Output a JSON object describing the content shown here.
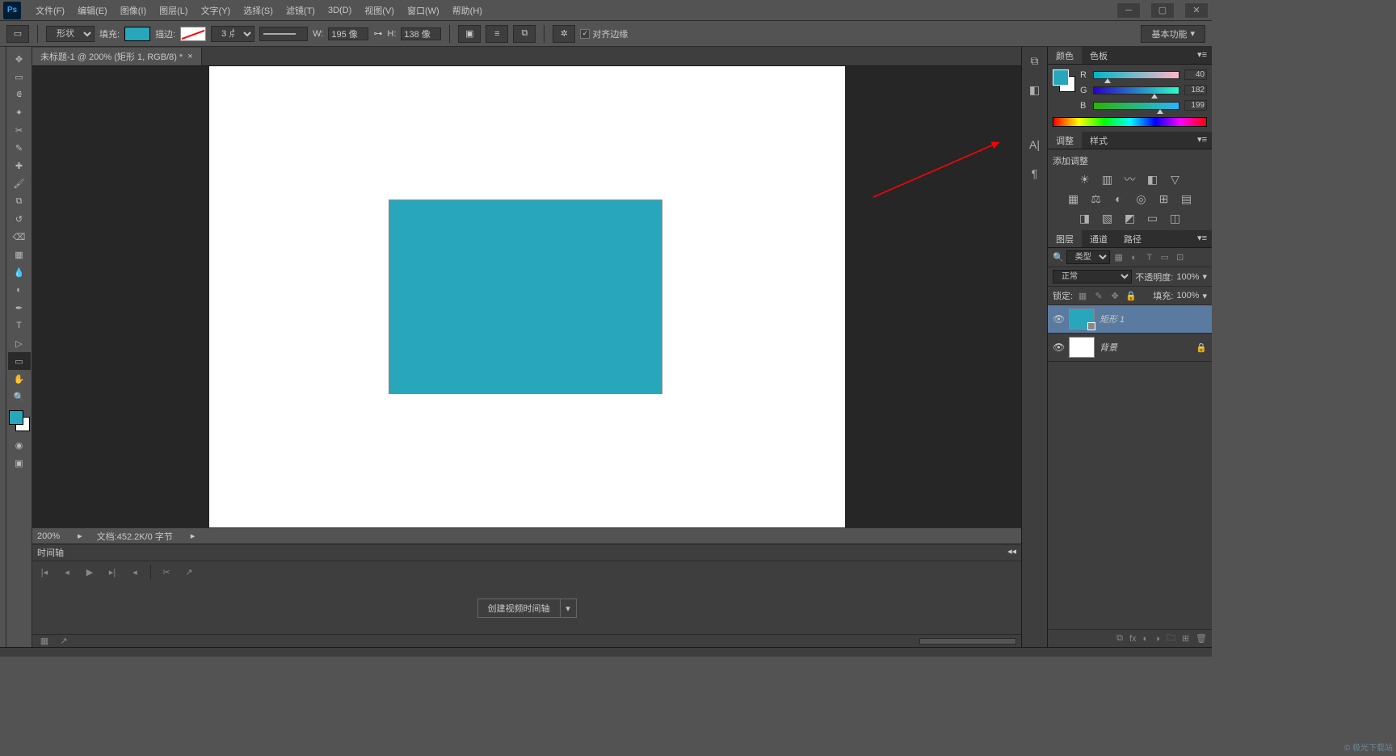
{
  "menubar": {
    "items": [
      "文件(F)",
      "编辑(E)",
      "图像(I)",
      "图层(L)",
      "文字(Y)",
      "选择(S)",
      "滤镜(T)",
      "3D(D)",
      "视图(V)",
      "窗口(W)",
      "帮助(H)"
    ]
  },
  "options": {
    "shape_mode": "形状",
    "fill_label": "填充:",
    "stroke_label": "描边:",
    "stroke_width": "3 点",
    "w_label": "W:",
    "w_value": "195 像",
    "h_label": "H:",
    "h_value": "138 像",
    "align_edges": "对齐边缘",
    "workspace": "基本功能"
  },
  "document": {
    "tab_title": "未标题-1 @ 200% (矩形 1, RGB/8) *",
    "zoom": "200%",
    "doc_info": "文档:452.2K/0 字节"
  },
  "timeline": {
    "title": "时间轴",
    "create_btn": "创建视频时间轴"
  },
  "color_panel": {
    "tab_color": "颜色",
    "tab_swatch": "色板",
    "r_label": "R",
    "r_value": "40",
    "g_label": "G",
    "g_value": "182",
    "b_label": "B",
    "b_value": "199",
    "fg_hex": "#28a6bc"
  },
  "adjustments": {
    "tab_adjust": "调整",
    "tab_style": "样式",
    "add_label": "添加调整"
  },
  "layers": {
    "tab_layers": "图层",
    "tab_channels": "通道",
    "tab_paths": "路径",
    "filter_kind": "类型",
    "blend_mode": "正常",
    "opacity_label": "不透明度:",
    "opacity_value": "100%",
    "lock_label": "锁定:",
    "fill_label": "填充:",
    "fill_value": "100%",
    "items": [
      {
        "name": "矩形 1",
        "selected": true,
        "locked": false,
        "thumb": "shape"
      },
      {
        "name": "背景",
        "selected": false,
        "locked": true,
        "thumb": "bg"
      }
    ]
  }
}
